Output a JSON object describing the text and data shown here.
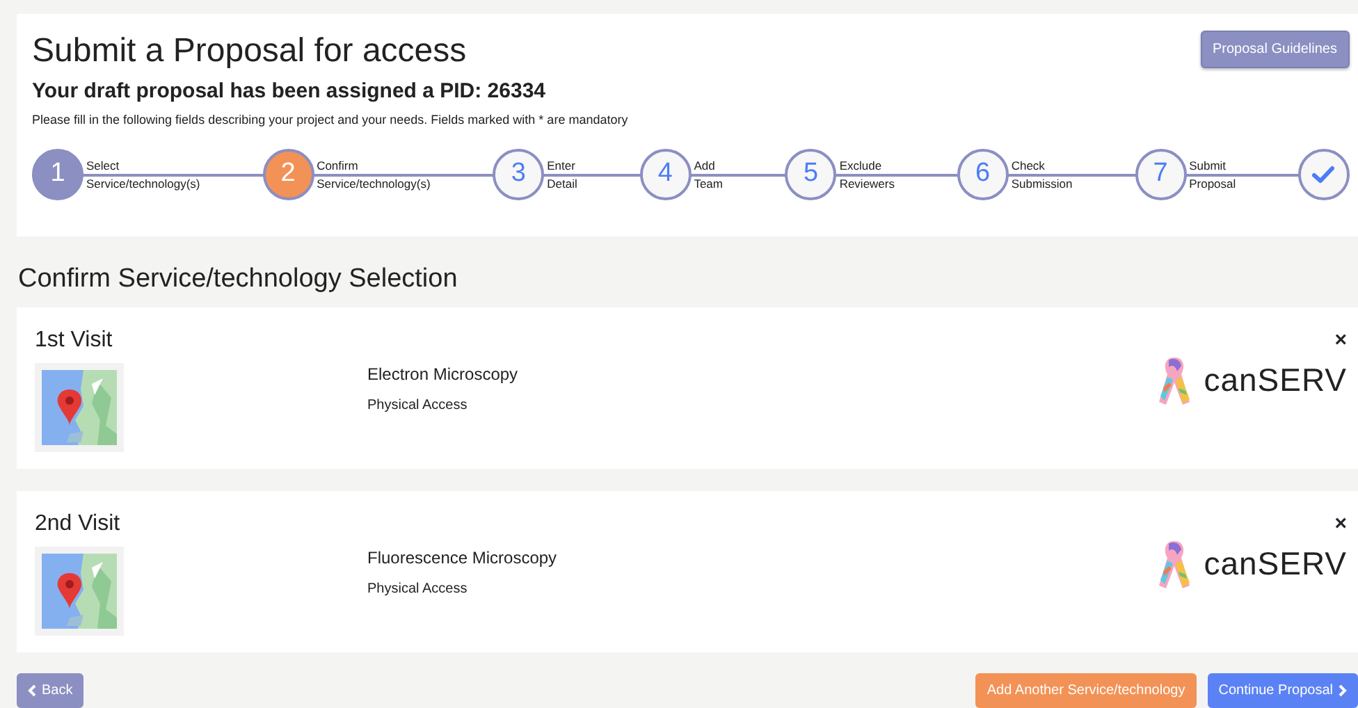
{
  "header": {
    "title": "Submit a Proposal for access",
    "subtitle": "Your draft proposal has been assigned a PID: 26334",
    "instructions": "Please fill in the following fields describing your project and your needs. Fields marked with * are mandatory",
    "guidelines_button": "Proposal Guidelines"
  },
  "steps": [
    {
      "kind": "number",
      "number": "1",
      "line1": "Select",
      "line2": "Service/technology(s)",
      "selected": false
    },
    {
      "kind": "number",
      "number": "2",
      "line1": "Confirm",
      "line2": "Service/technology(s)",
      "selected": true
    },
    {
      "kind": "number",
      "number": "3",
      "line1": "Enter",
      "line2": "Detail",
      "selected": false
    },
    {
      "kind": "number",
      "number": "4",
      "line1": "Add",
      "line2": "Team",
      "selected": false
    },
    {
      "kind": "number",
      "number": "5",
      "line1": "Exclude",
      "line2": "Reviewers",
      "selected": false
    },
    {
      "kind": "number",
      "number": "6",
      "line1": "Check",
      "line2": "Submission",
      "selected": false
    },
    {
      "kind": "number",
      "number": "7",
      "line1": "Submit",
      "line2": "Proposal",
      "selected": false
    },
    {
      "kind": "check",
      "selected": false
    }
  ],
  "section_title": "Confirm Service/technology Selection",
  "visits": [
    {
      "title": "1st Visit",
      "service": "Electron Microscopy",
      "access": "Physical Access",
      "logo": "canSERV",
      "remove": "×"
    },
    {
      "title": "2nd Visit",
      "service": "Fluorescence Microscopy",
      "access": "Physical Access",
      "logo": "canSERV",
      "remove": "×"
    }
  ],
  "footer": {
    "back": "Back",
    "add": "Add Another Service/technology",
    "continue": "Continue Proposal"
  }
}
